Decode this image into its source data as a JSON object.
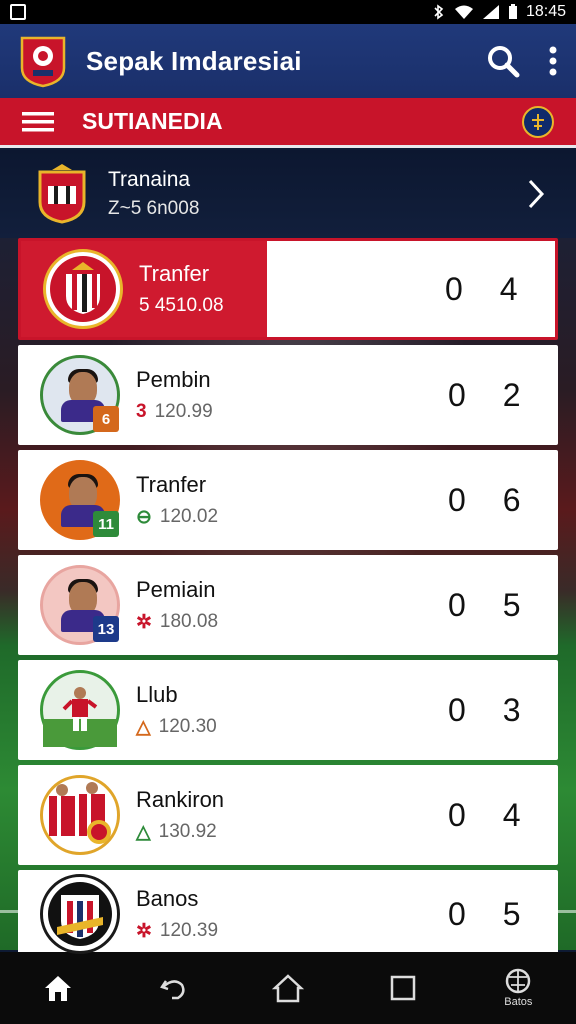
{
  "status_bar": {
    "time": "18:45"
  },
  "app_bar": {
    "title": "Sepak Imdaresiai"
  },
  "section": {
    "title": "SUTIANEDIA"
  },
  "team": {
    "name": "Tranaina",
    "sub": "Z~5 6n008"
  },
  "items": [
    {
      "name": "Tranfer",
      "meta": "5 4510.08",
      "mark": "",
      "score": "0 4",
      "featured": true
    },
    {
      "name": "Pembin",
      "meta": "120.99",
      "mark": "3",
      "mark_color": "#c8142a",
      "score": "0 2",
      "number": "6",
      "number_color": "#d4681c",
      "ring": "#3a8a3a"
    },
    {
      "name": "Tranfer",
      "meta": "120.02",
      "mark": "⊖",
      "mark_color": "#2e8b3a",
      "score": "0 6",
      "number": "11",
      "number_color": "#2e8b3a",
      "ring": "#e06a18"
    },
    {
      "name": "Pemiain",
      "meta": "180.08",
      "mark": "✲",
      "mark_color": "#c8142a",
      "score": "0 5",
      "number": "13",
      "number_color": "#1d3a8a",
      "ring": "#e8a5a0"
    },
    {
      "name": "Llub",
      "meta": "120.30",
      "mark": "△",
      "mark_color": "#d4681c",
      "score": "0 3",
      "ring": "#3a9a3a"
    },
    {
      "name": "Rankiron",
      "meta": "130.92",
      "mark": "△",
      "mark_color": "#2e8b3a",
      "score": "0 4",
      "ring": "#e0a52a"
    },
    {
      "name": "Banos",
      "meta": "120.39",
      "mark": "✲",
      "mark_color": "#c8142a",
      "score": "0 5",
      "ring": "#1a1a1a"
    }
  ],
  "bottom_nav": {
    "last_label": "Batos"
  }
}
